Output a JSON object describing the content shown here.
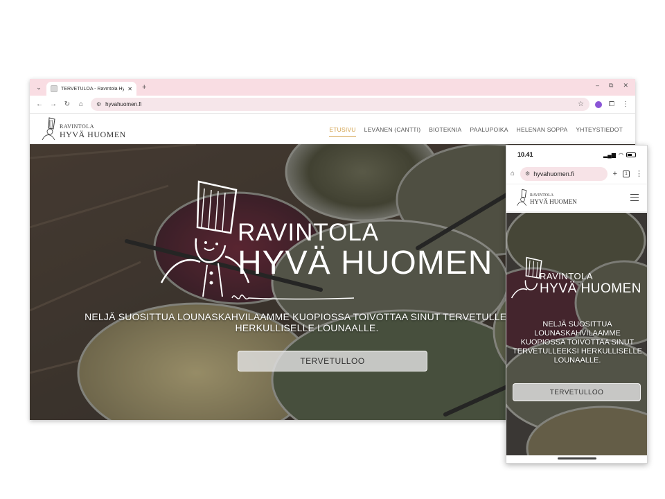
{
  "desktop": {
    "tab": {
      "title": "TERVETULOA - Ravintola Hyvä Huomen",
      "close": "✕"
    },
    "new_tab": "+",
    "window_controls": {
      "minimize": "–",
      "restore": "⧉",
      "close": "✕"
    },
    "toolbar": {
      "back": "←",
      "forward": "→",
      "reload": "↻",
      "home": "⌂",
      "url": "hyvahuomen.fi",
      "star": "☆",
      "menu": "⋮"
    },
    "logo": {
      "line1": "RAVINTOLA",
      "line2": "HYVÄ HUOMEN"
    },
    "nav": [
      {
        "label": "ETUSIVU",
        "active": true
      },
      {
        "label": "LEVÄNEN (CANTTI)"
      },
      {
        "label": "BIOTEKNIA"
      },
      {
        "label": "PAALUPOIKA"
      },
      {
        "label": "HELENAN SOPPA"
      },
      {
        "label": "YHTEYSTIEDOT"
      }
    ],
    "hero": {
      "title1": "RAVINTOLA",
      "title2": "HYVÄ HUOMEN",
      "tagline": "NELJÄ SUOSITTUA LOUNASKAHVILAAMME KUOPIOSSA TOIVOTTAA SINUT TERVETULLEEKSI HERKULLISELLE LOUNAALLE.",
      "button": "TERVETULLOO"
    }
  },
  "mobile": {
    "status": {
      "time": "10.41",
      "signal": "▂▄▆",
      "wifi": "◠"
    },
    "toolbar": {
      "home": "⌂",
      "url": "hyvahuomen.fi",
      "new_tab": "+",
      "tabs_count": "1",
      "menu": "⋮"
    },
    "logo": {
      "line1": "RAVINTOLA",
      "line2": "HYVÄ HUOMEN"
    },
    "hero": {
      "title1": "RAVINTOLA",
      "title2": "HYVÄ HUOMEN",
      "tagline": "NELJÄ SUOSITTUA LOUNASKAHVILAAMME KUOPIOSSA TOIVOTTAA SINUT TERVETULLEEKSI HERKULLISELLE LOUNAALLE.",
      "button": "TERVETULLOO"
    }
  }
}
